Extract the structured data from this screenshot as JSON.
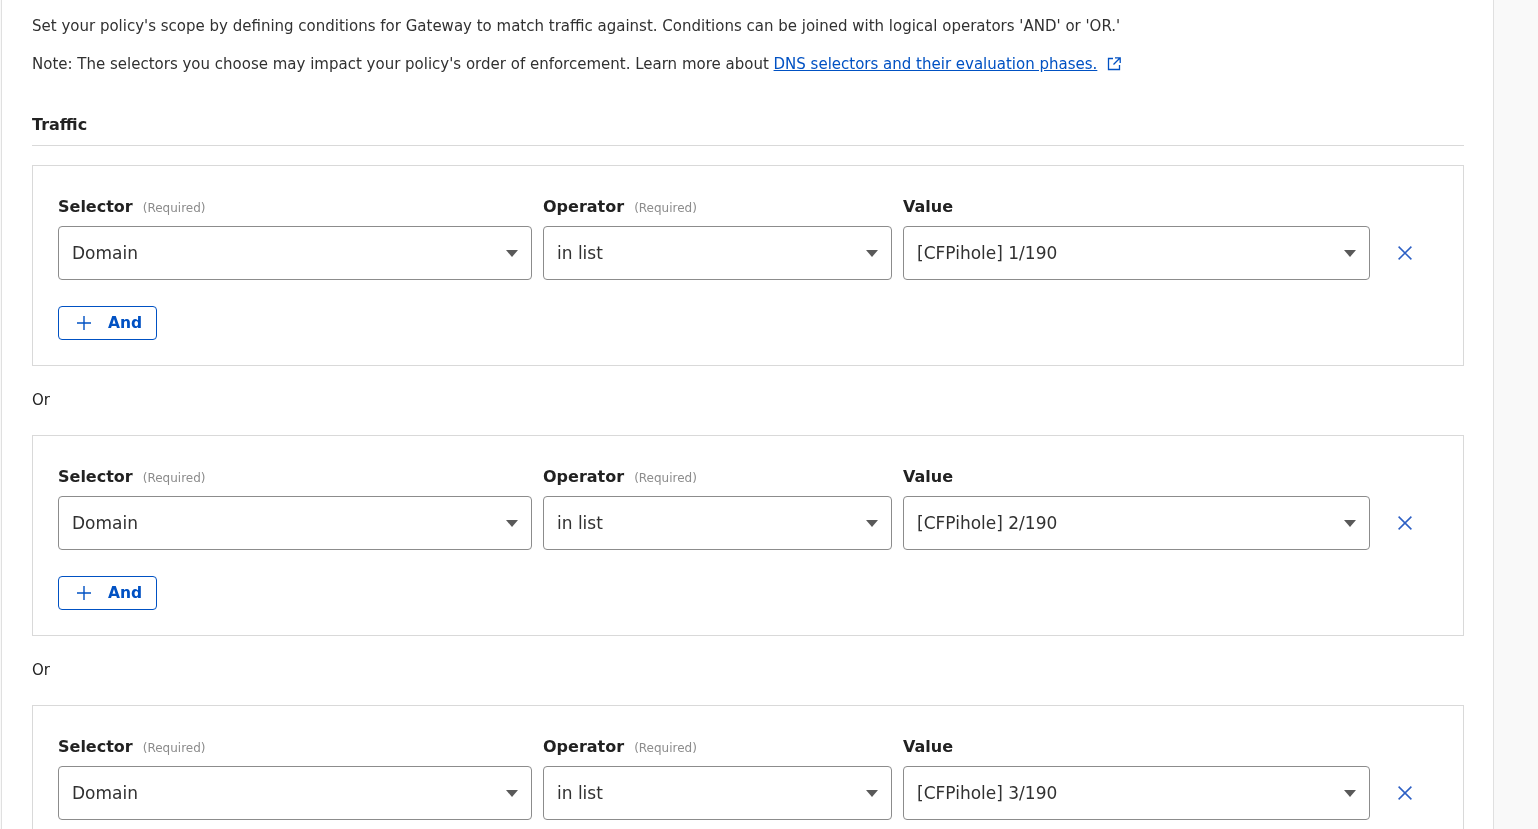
{
  "intro": "Set your policy's scope by defining conditions for Gateway to match traffic against. Conditions can be joined with logical operators 'AND' or 'OR.'",
  "note": {
    "text": "Note: The selectors you choose may impact your policy's order of enforcement. Learn more about",
    "link": "DNS selectors and their evaluation phases."
  },
  "section_title": "Traffic",
  "groups": [
    {
      "fields": [
        {
          "label": "Selector",
          "hint": "(Required)",
          "value": "Domain"
        },
        {
          "label": "Operator",
          "hint": "(Required)",
          "value": "in list"
        },
        {
          "label": "Value",
          "value": "[CFPihole] 1/190"
        }
      ],
      "add_button": "And"
    },
    {
      "joiner": "Or",
      "fields": [
        {
          "label": "Selector",
          "hint": "(Required)",
          "value": "Domain"
        },
        {
          "label": "Operator",
          "hint": "(Required)",
          "value": "in list"
        },
        {
          "label": "Value",
          "value": "[CFPihole] 2/190"
        }
      ],
      "add_button": "And"
    },
    {
      "joiner": "Or",
      "fields": [
        {
          "label": "Selector",
          "hint": "(Required)",
          "value": "Domain"
        },
        {
          "label": "Operator",
          "hint": "(Required)",
          "value": "in list"
        },
        {
          "label": "Value",
          "value": "[CFPihole] 3/190"
        }
      ]
    }
  ]
}
